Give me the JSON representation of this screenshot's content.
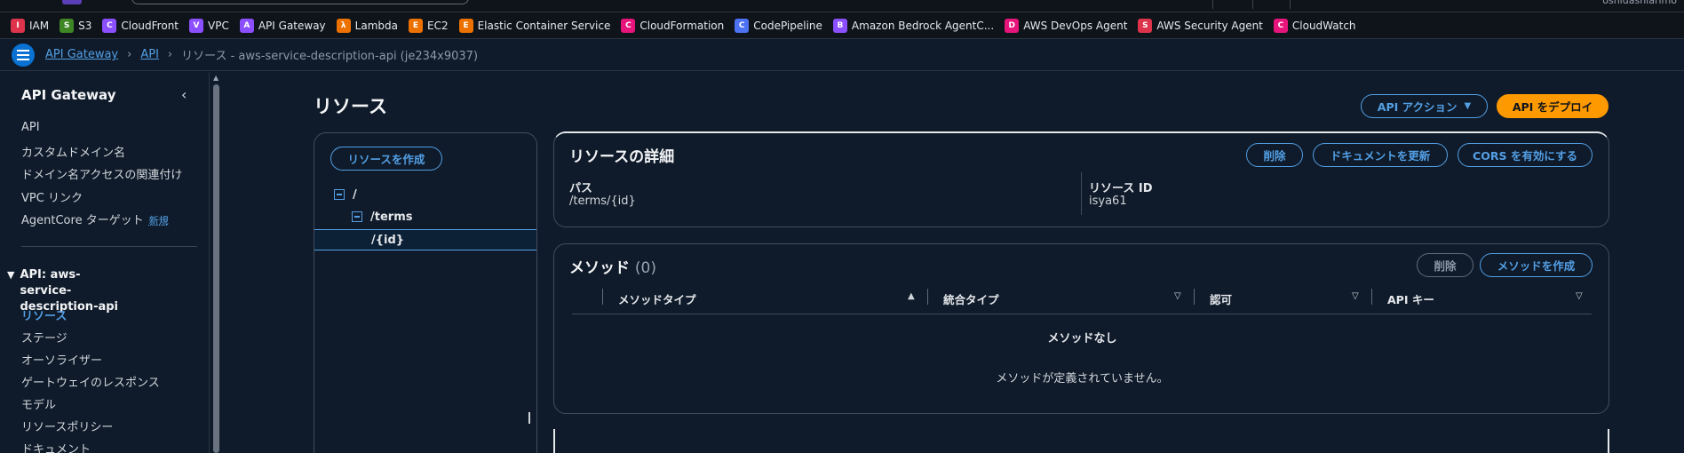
{
  "topbar": {
    "user": "oshidashiarimo"
  },
  "favorites": [
    {
      "label": "IAM",
      "color": "#dd344c",
      "icon": "iam-icon",
      "glyph": "I"
    },
    {
      "label": "S3",
      "color": "#3f8624",
      "icon": "s3-icon",
      "glyph": "S"
    },
    {
      "label": "CloudFront",
      "color": "#8c4fff",
      "icon": "cloudfront-icon",
      "glyph": "C"
    },
    {
      "label": "VPC",
      "color": "#8c4fff",
      "icon": "vpc-icon",
      "glyph": "V"
    },
    {
      "label": "API Gateway",
      "color": "#8c4fff",
      "icon": "api-gateway-icon",
      "glyph": "A"
    },
    {
      "label": "Lambda",
      "color": "#ed7100",
      "icon": "lambda-icon",
      "glyph": "λ"
    },
    {
      "label": "EC2",
      "color": "#ed7100",
      "icon": "ec2-icon",
      "glyph": "E"
    },
    {
      "label": "Elastic Container Service",
      "color": "#ed7100",
      "icon": "ecs-icon",
      "glyph": "E"
    },
    {
      "label": "CloudFormation",
      "color": "#e7157b",
      "icon": "cloudformation-icon",
      "glyph": "C"
    },
    {
      "label": "CodePipeline",
      "color": "#4d72f3",
      "icon": "codepipeline-icon",
      "glyph": "C"
    },
    {
      "label": "Amazon Bedrock AgentC...",
      "color": "#8c4fff",
      "icon": "bedrock-icon",
      "glyph": "B"
    },
    {
      "label": "AWS DevOps Agent",
      "color": "#e7157b",
      "icon": "devops-agent-icon",
      "glyph": "D"
    },
    {
      "label": "AWS Security Agent",
      "color": "#dd344c",
      "icon": "security-agent-icon",
      "glyph": "S"
    },
    {
      "label": "CloudWatch",
      "color": "#e7157b",
      "icon": "cloudwatch-icon",
      "glyph": "C"
    }
  ],
  "breadcrumb": {
    "items": [
      "API Gateway",
      "API"
    ],
    "current": "リソース - aws-service-description-api (je234x9037)"
  },
  "sidebar": {
    "title": "API Gateway",
    "items": [
      "API",
      "カスタムドメイン名",
      "ドメイン名アクセスの関連付け",
      "VPC リンク",
      "AgentCore ターゲット"
    ],
    "new_badge": "新規",
    "section": "API: aws-service-description-api",
    "section_items": [
      "リソース",
      "ステージ",
      "オーソライザー",
      "ゲートウェイのレスポンス",
      "モデル",
      "リソースポリシー",
      "ドキュメント"
    ]
  },
  "main": {
    "title": "リソース",
    "api_actions": "API アクション",
    "deploy": "API をデプロイ",
    "create_resource": "リソースを作成",
    "tree": [
      "/",
      "/terms",
      "/{id}"
    ],
    "details": {
      "heading": "リソースの詳細",
      "delete": "削除",
      "update_docs": "ドキュメントを更新",
      "enable_cors": "CORS を有効にする",
      "path_label": "パス",
      "path_value": "/terms/{id}",
      "id_label": "リソース ID",
      "id_value": "isya61"
    },
    "methods": {
      "heading": "メソッド",
      "count": "(0)",
      "delete": "削除",
      "create": "メソッドを作成",
      "columns": [
        "メソッドタイプ",
        "統合タイプ",
        "認可",
        "API キー"
      ],
      "empty_title": "メソッドなし",
      "empty_desc": "メソッドが定義されていません。"
    }
  }
}
